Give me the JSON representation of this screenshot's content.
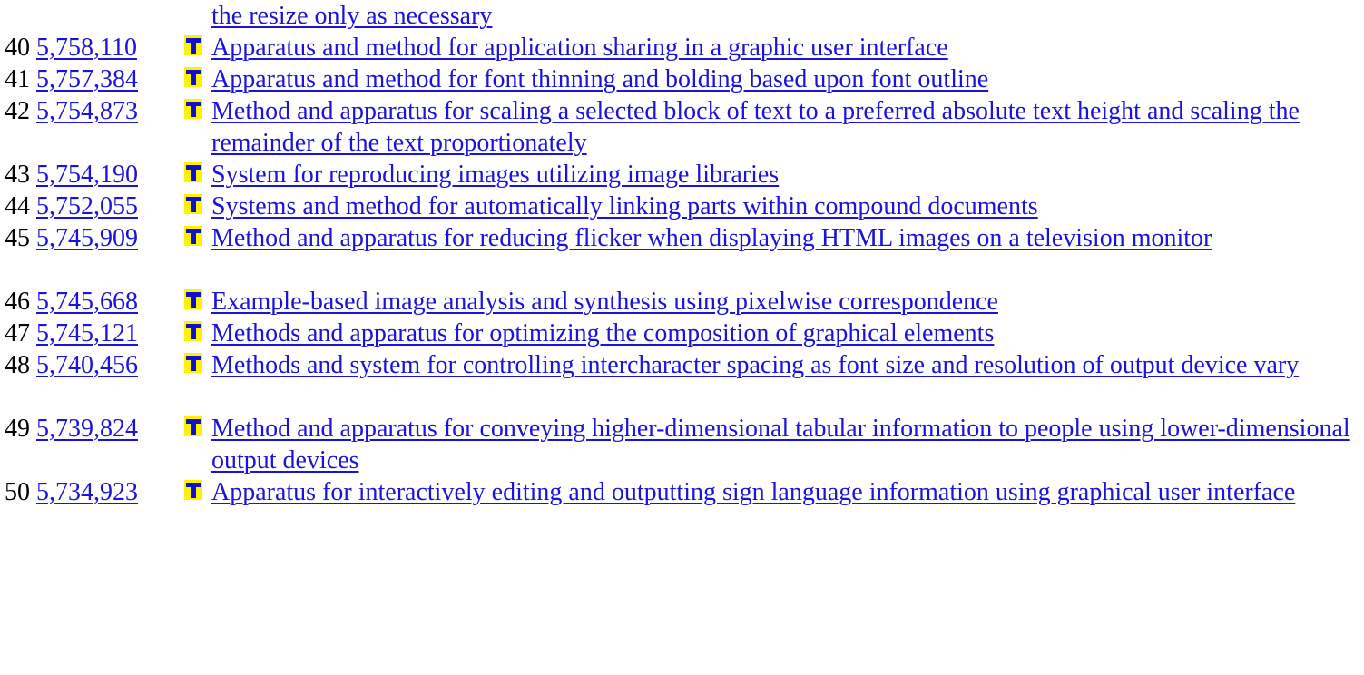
{
  "colors": {
    "link": "#1a14d8",
    "icon_bg": "#fff200",
    "icon_fg": "#1010c8"
  },
  "icon_name": "T-icon (full text image link)",
  "continued_title": "the resize only as necessary",
  "results": [
    {
      "num": "40",
      "patent": "5,758,110",
      "title": "Apparatus and method for application sharing in a graphic user interface"
    },
    {
      "num": "41",
      "patent": "5,757,384",
      "title": "Apparatus and method for font thinning and bolding based upon font outline"
    },
    {
      "num": "42",
      "patent": "5,754,873",
      "title": "Method and apparatus for scaling a selected block of text to a preferred absolute text height and scaling the remainder of the text proportionately"
    },
    {
      "num": "43",
      "patent": "5,754,190",
      "title": "System for reproducing images utilizing image libraries"
    },
    {
      "num": "44",
      "patent": "5,752,055",
      "title": "Systems and method for automatically linking parts within compound documents"
    },
    {
      "num": "45",
      "patent": "5,745,909",
      "title": "Method and apparatus for reducing flicker when displaying HTML images on a television monitor"
    },
    {
      "num": "46",
      "patent": "5,745,668",
      "title": "Example-based image analysis and synthesis using pixelwise correspondence"
    },
    {
      "num": "47",
      "patent": "5,745,121",
      "title": "Methods and apparatus for optimizing the composition of graphical elements"
    },
    {
      "num": "48",
      "patent": "5,740,456",
      "title": "Methods and system for controlling intercharacter spacing as font size and resolution of output device vary"
    },
    {
      "num": "49",
      "patent": "5,739,824",
      "title": "Method and apparatus for conveying higher-dimensional tabular information to people using lower-dimensional output devices"
    },
    {
      "num": "50",
      "patent": "5,734,923",
      "title": "Apparatus for interactively editing and outputting sign language information using graphical user interface"
    }
  ]
}
